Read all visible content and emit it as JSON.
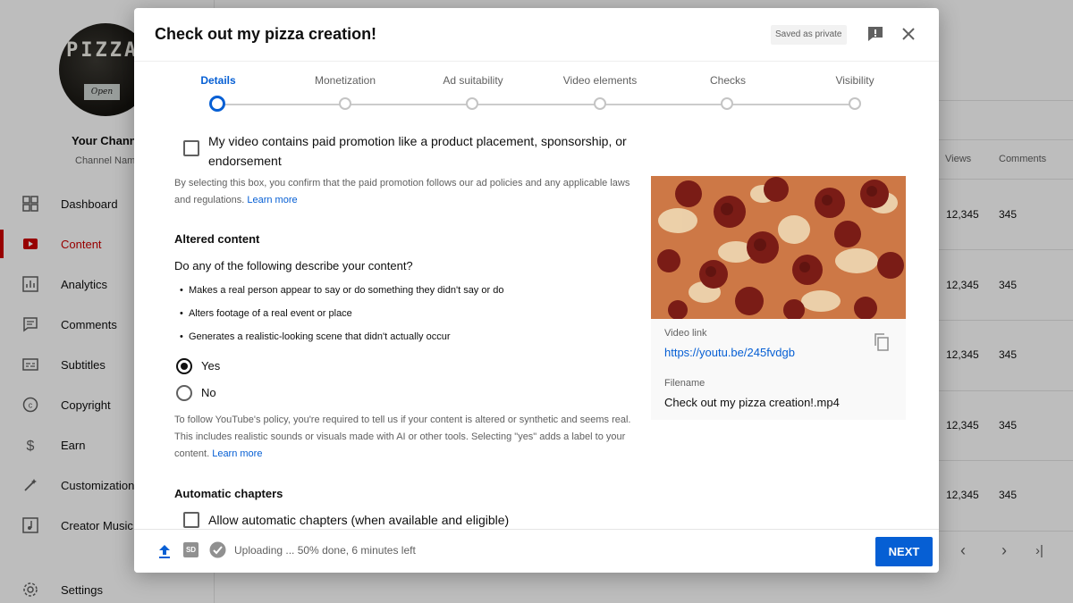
{
  "sidebar": {
    "avatar_text": "PIZZA",
    "avatar_sign": "Open",
    "channel_title": "Your Channel",
    "channel_name": "Channel Name",
    "items": [
      {
        "label": "Dashboard",
        "icon": "dashboard-icon",
        "active": false
      },
      {
        "label": "Content",
        "icon": "content-icon",
        "active": true
      },
      {
        "label": "Analytics",
        "icon": "analytics-icon",
        "active": false
      },
      {
        "label": "Comments",
        "icon": "comments-icon",
        "active": false
      },
      {
        "label": "Subtitles",
        "icon": "subtitles-icon",
        "active": false
      },
      {
        "label": "Copyright",
        "icon": "copyright-icon",
        "active": false
      },
      {
        "label": "Earn",
        "icon": "earn-icon",
        "active": false
      },
      {
        "label": "Customization",
        "icon": "customization-icon",
        "active": false
      },
      {
        "label": "Creator Music",
        "icon": "music-icon",
        "active": false
      },
      {
        "label": "Settings",
        "icon": "settings-icon",
        "active": false
      }
    ]
  },
  "table": {
    "col_views": "Views",
    "col_comments": "Comments",
    "rows": [
      {
        "views": "12,345",
        "comments": "345"
      },
      {
        "views": "12,345",
        "comments": "345"
      },
      {
        "views": "12,345",
        "comments": "345"
      },
      {
        "views": "12,345",
        "comments": "345"
      },
      {
        "views": "12,345",
        "comments": "345"
      }
    ]
  },
  "dialog": {
    "title": "Check out my pizza creation!",
    "saved_badge": "Saved as private",
    "steps": [
      "Details",
      "Monetization",
      "Ad suitability",
      "Video elements",
      "Checks",
      "Visibility"
    ],
    "active_step": 0,
    "paid_promotion": {
      "label": "My video contains paid promotion like a product placement, sponsorship, or endorsement",
      "checked": false,
      "note": "By selecting this box, you confirm that the paid promotion follows our ad policies and any applicable laws and regulations.",
      "note_link": "Learn more"
    },
    "altered_content": {
      "title": "Altered content",
      "question": "Do any of the following describe your content?",
      "bullets": [
        "Makes a real person appear to say or do something they didn't say or do",
        "Alters footage of a real event or place",
        "Generates a realistic-looking scene that didn't actually occur"
      ],
      "options": [
        {
          "label": "Yes",
          "checked": true
        },
        {
          "label": "No",
          "checked": false
        }
      ],
      "policy_note": "To follow YouTube's policy, you're required to tell us if your content is altered or synthetic and seems real. This includes realistic sounds or visuals made with AI or other tools. Selecting \"yes\" adds a label to your content.",
      "policy_link": "Learn more"
    },
    "chapters": {
      "title": "Automatic chapters",
      "label": "Allow automatic chapters (when available and eligible)",
      "checked": false
    },
    "preview": {
      "video_link_label": "Video link",
      "video_link": "https://youtu.be/245fvdgb",
      "filename_label": "Filename",
      "filename": "Check out my pizza creation!.mp4"
    },
    "footer": {
      "status": "Uploading ... 50% done, 6 minutes left",
      "upload_progress_percent": 50,
      "hd_badge": "SD",
      "next_label": "NEXT"
    }
  },
  "colors": {
    "accent_blue": "#065fd4",
    "youtube_red": "#cc0000"
  }
}
